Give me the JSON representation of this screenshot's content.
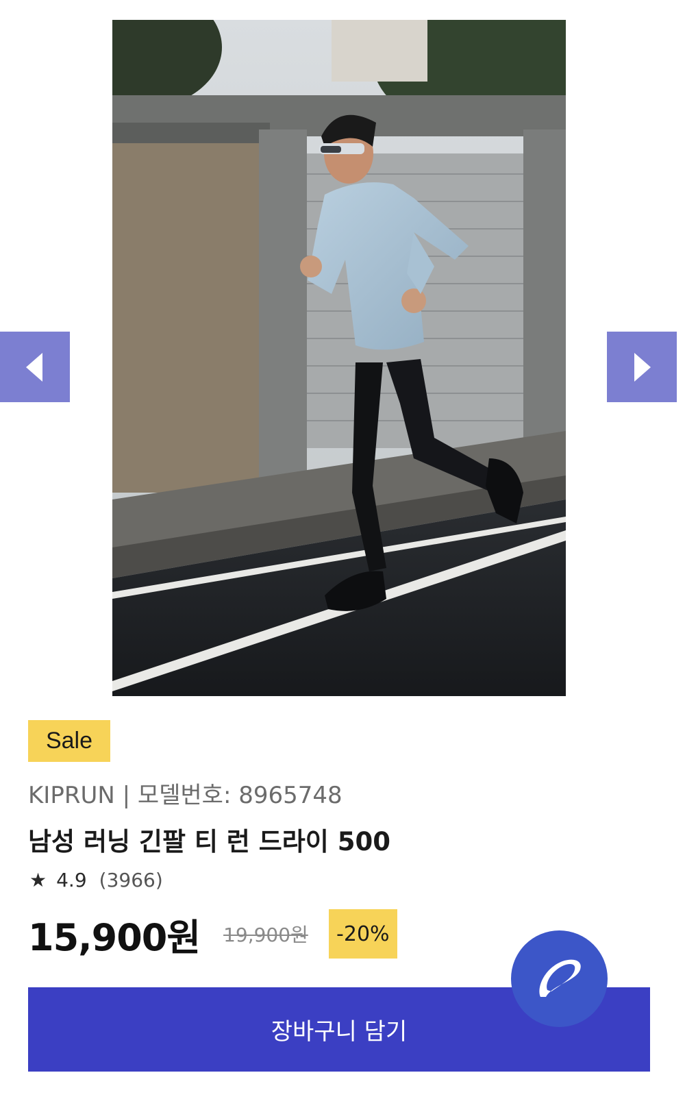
{
  "gallery": {
    "image_alt": "남성 러닝 긴팔 티 런 드라이 500",
    "prev_icon": "caret-left-icon",
    "next_icon": "caret-right-icon"
  },
  "product": {
    "sale_badge": "Sale",
    "brand_line": "KIPRUN | 모델번호: 8965748",
    "title": "남성 러닝 긴팔 티 런 드라이 500",
    "rating": {
      "star": "★",
      "score": "4.9",
      "count": "(3966)"
    },
    "price": {
      "current": "15,900원",
      "original": "19,900원",
      "discount": "-20%"
    }
  },
  "actions": {
    "add_to_cart": "장바구니 담기",
    "fab_icon": "brand-swoosh-icon"
  },
  "colors": {
    "accent": "#3b3fc3",
    "arrow_bg": "#7c7fd1",
    "badge_yellow": "#f7d358",
    "fab": "#3c56c8"
  }
}
